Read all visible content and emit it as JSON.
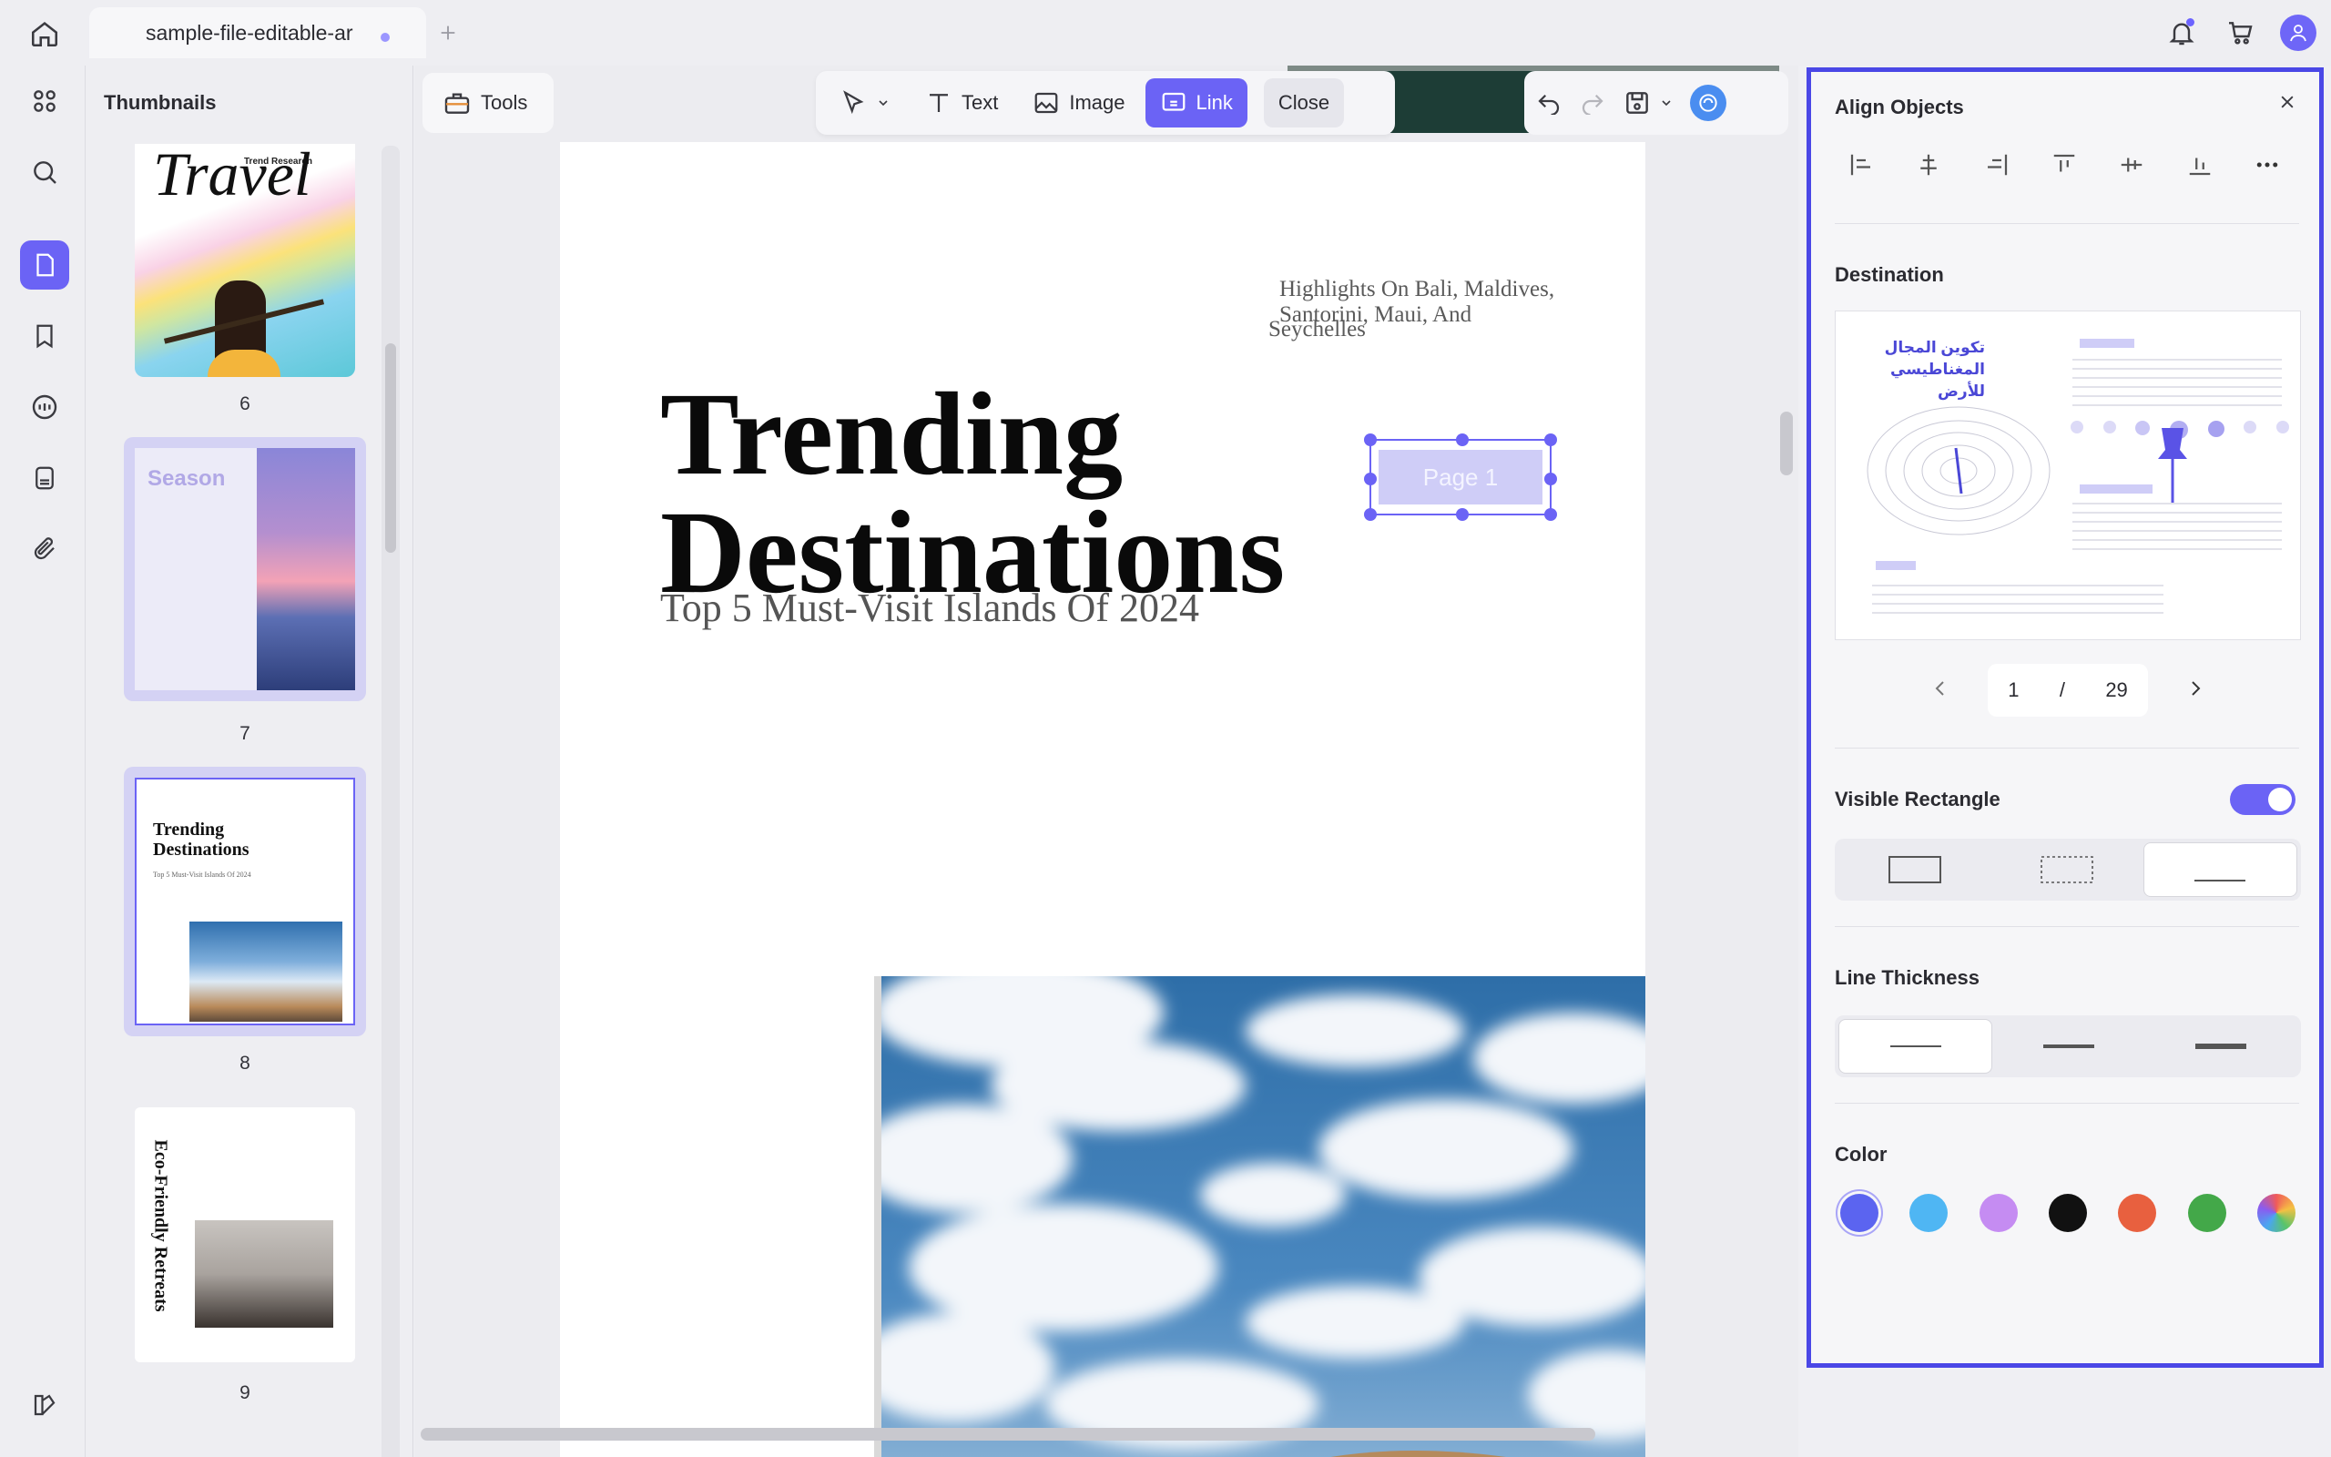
{
  "tab": {
    "title": "sample-file-editable-ar"
  },
  "thumbnails": {
    "title": "Thumbnails",
    "pages": [
      {
        "num": "6",
        "brand": "Trend Research",
        "headline": "Travel"
      },
      {
        "num": "7",
        "headline": "Season"
      },
      {
        "num": "8",
        "headline": "Trending Destinations",
        "sub": "Top 5 Must-Visit Islands Of 2024"
      },
      {
        "num": "9",
        "headline": "Eco-Friendly Retreats"
      }
    ]
  },
  "toolbar": {
    "tools": "Tools",
    "text": "Text",
    "image": "Image",
    "link": "Link",
    "close": "Close"
  },
  "document": {
    "highlights_line1": "Highlights On Bali, Maldives, Santorini, Maui, And",
    "highlights_line2": "Seychelles",
    "title_line1": "Trending",
    "title_line2": "Destinations",
    "subtitle": "Top 5 Must-Visit Islands Of 2024",
    "link_label": "Page 1"
  },
  "panel": {
    "align_title": "Align Objects",
    "destination_label": "Destination",
    "preview_heading_line1": "تكوين المجال",
    "preview_heading_line2": "المغناطيسي للأرض",
    "page_current": "1",
    "page_sep": "/",
    "page_total": "29",
    "visible_rect_label": "Visible Rectangle",
    "visible_rect_on": true,
    "line_thickness_label": "Line Thickness",
    "color_label": "Color",
    "colors": [
      "#5b64f0",
      "#4fb6f3",
      "#c58cf2",
      "#111111",
      "#e8603f",
      "#43a849",
      "conic"
    ]
  }
}
